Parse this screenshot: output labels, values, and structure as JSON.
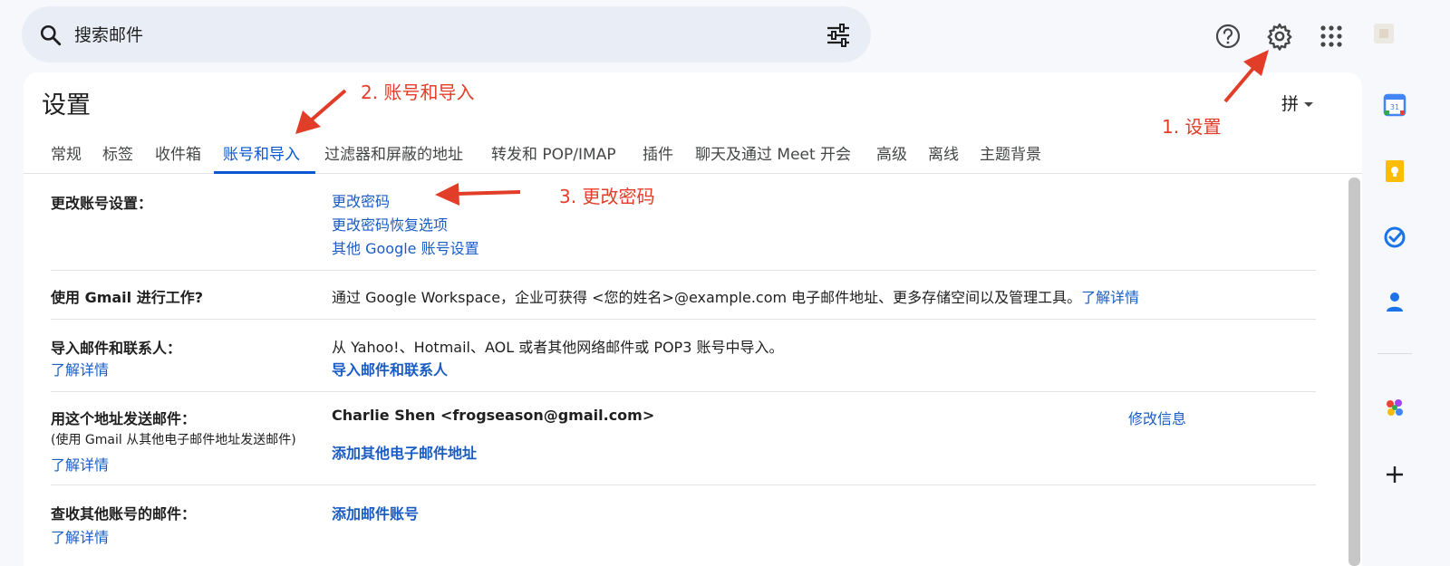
{
  "search": {
    "placeholder": "搜索邮件"
  },
  "header": {
    "title": "设置",
    "ime_label": "拼"
  },
  "tabs": [
    {
      "label": "常规"
    },
    {
      "label": "标签"
    },
    {
      "label": "收件箱"
    },
    {
      "label": "账号和导入",
      "active": true
    },
    {
      "label": "过滤器和屏蔽的地址"
    },
    {
      "label": "转发和 POP/IMAP"
    },
    {
      "label": "插件"
    },
    {
      "label": "聊天及通过 Meet 开会"
    },
    {
      "label": "高级"
    },
    {
      "label": "离线"
    },
    {
      "label": "主题背景"
    }
  ],
  "sections": {
    "change_account": {
      "label": "更改账号设置：",
      "links": [
        "更改密码",
        "更改密码恢复选项",
        "其他 Google 账号设置"
      ]
    },
    "workspace": {
      "label": "使用 Gmail 进行工作?",
      "text": "通过 Google Workspace，企业可获得 <您的姓名>@example.com 电子邮件地址、更多存储空间以及管理工具。",
      "link": "了解详情"
    },
    "import": {
      "label": "导入邮件和联系人：",
      "learn_more": "了解详情",
      "text": "从 Yahoo!、Hotmail、AOL 或者其他网络邮件或 POP3 账号中导入。",
      "action": "导入邮件和联系人"
    },
    "send_as": {
      "label": "用这个地址发送邮件：",
      "sublabel": "(使用 Gmail 从其他电子邮件地址发送邮件)",
      "learn_more": "了解详情",
      "address": "Charlie Shen <frogseason@gmail.com>",
      "edit": "修改信息",
      "add": "添加其他电子邮件地址"
    },
    "check_mail": {
      "label": "查收其他账号的邮件：",
      "learn_more": "了解详情",
      "add": "添加邮件账号"
    }
  },
  "annotations": {
    "step1": "1. 设置",
    "step2": "2. 账号和导入",
    "step3": "3. 更改密码"
  },
  "colors": {
    "accent": "#0b57d0",
    "link": "#1a5cc4",
    "annotation": "#e23d28"
  }
}
